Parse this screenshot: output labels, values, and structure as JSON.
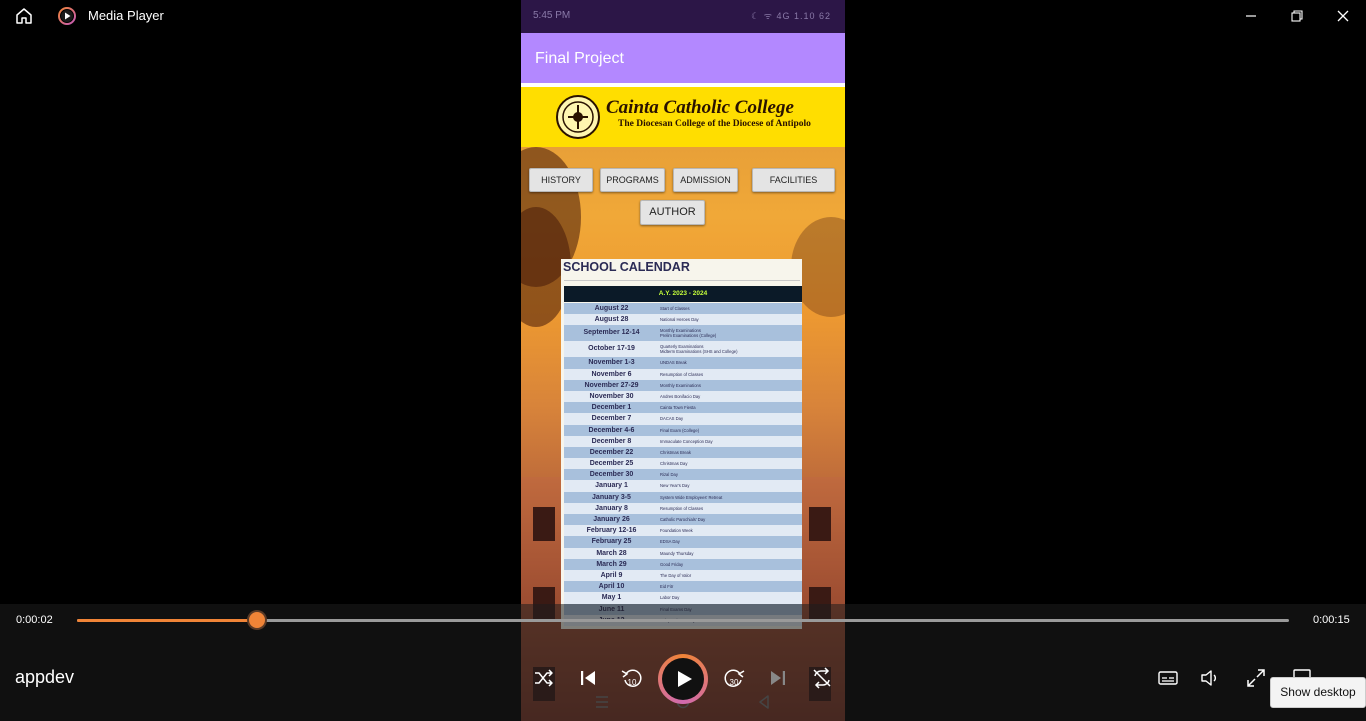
{
  "window": {
    "app_name": "Media Player",
    "icons": [
      "home-icon",
      "media-player-icon",
      "minimize-icon",
      "restore-icon",
      "close-icon"
    ]
  },
  "phone": {
    "status_time": "5:45 PM",
    "status_icons": "☾ ᯤ 4G 1.10 62",
    "app_title": "Final Project",
    "college_name": "Cainta Catholic College",
    "college_subtitle": "The Diocesan College of the Diocese of Antipolo",
    "nav_buttons": [
      "HISTORY",
      "PROGRAMS",
      "ADMISSION",
      "FACILITIES"
    ],
    "author_button": "AUTHOR",
    "calendar": {
      "title": "SCHOOL CALENDAR",
      "year_header": "A.Y. 2023 - 2024",
      "rows": [
        {
          "date": "August 22",
          "event": "Start of Classes"
        },
        {
          "date": "August 28",
          "event": "National Heroes Day"
        },
        {
          "date": "September 12-14",
          "event": "Monthly Examinations\nPrelim Examinations (College)"
        },
        {
          "date": "October 17-19",
          "event": "Quarterly Examinations\nMidterm Examinations (SHS and College)"
        },
        {
          "date": "November 1-3",
          "event": "UNDAS Break"
        },
        {
          "date": "November 6",
          "event": "Resumption of Classes"
        },
        {
          "date": "November 27-29",
          "event": "Monthly Examinations"
        },
        {
          "date": "November 30",
          "event": "Andres Bonifacio Day"
        },
        {
          "date": "December 1",
          "event": "Cainta Town Fiesta"
        },
        {
          "date": "December 7",
          "event": "DACAS Day"
        },
        {
          "date": "December 4-6",
          "event": "Final Exam (College)"
        },
        {
          "date": "December 8",
          "event": "Immaculate Conception Day"
        },
        {
          "date": "December 22",
          "event": "Christmas Break"
        },
        {
          "date": "December 25",
          "event": "Christmas Day"
        },
        {
          "date": "December 30",
          "event": "Rizal Day"
        },
        {
          "date": "January 1",
          "event": "New Year's Day"
        },
        {
          "date": "January 3-5",
          "event": "System Wide Employees' Retreat"
        },
        {
          "date": "January 8",
          "event": "Resumption of Classes"
        },
        {
          "date": "January 26",
          "event": "Catholic Parochials' Day"
        },
        {
          "date": "February 12-16",
          "event": "Foundation Week"
        },
        {
          "date": "February 25",
          "event": "EDSA Day"
        },
        {
          "date": "March 28",
          "event": "Maundy Thursday"
        },
        {
          "date": "March 29",
          "event": "Good Friday"
        },
        {
          "date": "April 9",
          "event": "The Day of Valor"
        },
        {
          "date": "April 10",
          "event": "Eid Fitr"
        },
        {
          "date": "May 1",
          "event": "Labor Day"
        },
        {
          "date": "June 11",
          "event": "Final Exams Day"
        },
        {
          "date": "June 12",
          "event": "Independence Day"
        }
      ]
    }
  },
  "player": {
    "current_time": "0:00:02",
    "total_time": "0:00:15",
    "progress_fraction": 0.1485,
    "video_title": "appdev",
    "skip_back_label": "10",
    "skip_forward_label": "30",
    "tooltip": "Show desktop",
    "accent_color": "#f08437"
  }
}
